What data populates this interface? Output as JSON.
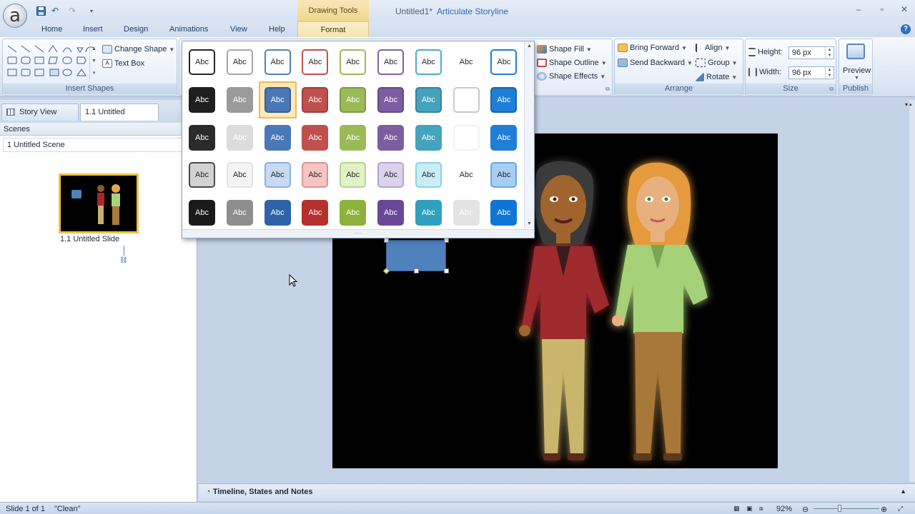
{
  "titlebar": {
    "document_title": "Untitled1*",
    "app_name": "Articulate Storyline",
    "context_tools": "Drawing Tools"
  },
  "tabs": [
    "Home",
    "Insert",
    "Design",
    "Animations",
    "View",
    "Help"
  ],
  "context_tab": "Format",
  "ribbon": {
    "insert_shapes_label": "Insert Shapes",
    "change_shape": "Change Shape",
    "text_box": "Text Box",
    "shape_fill": "Shape Fill",
    "shape_outline": "Shape Outline",
    "shape_effects": "Shape Effects",
    "bring_forward": "Bring Forward",
    "send_backward": "Send Backward",
    "align": "Align",
    "group": "Group",
    "rotate": "Rotate",
    "arrange_label": "Arrange",
    "height_label": "Height:",
    "height_value": "96 px",
    "width_label": "Width:",
    "width_value": "96 px",
    "size_label": "Size",
    "preview": "Preview",
    "publish_label": "Publish"
  },
  "left_panel": {
    "story_view_tab": "Story View",
    "slide_tab": "1.1 Untitled Slide",
    "scenes_header": "Scenes",
    "scene_item": "1 Untitled Scene",
    "thumb_label": "1.1 Untitled Slide"
  },
  "gallery": {
    "swatch_text": "Abc",
    "rows": [
      [
        {
          "fill": "#ffffff",
          "border": "#262626",
          "text": "#262626"
        },
        {
          "fill": "#ffffff",
          "border": "#a6a6a6",
          "text": "#262626"
        },
        {
          "fill": "#ffffff",
          "border": "#4f81bd",
          "text": "#262626"
        },
        {
          "fill": "#ffffff",
          "border": "#c0504d",
          "text": "#262626"
        },
        {
          "fill": "#ffffff",
          "border": "#9bbb59",
          "text": "#262626"
        },
        {
          "fill": "#ffffff",
          "border": "#8064a2",
          "text": "#262626"
        },
        {
          "fill": "#ffffff",
          "border": "#4bacc6",
          "text": "#262626"
        },
        {
          "fill": "#ffffff",
          "border": "#ffffff",
          "text": "#262626"
        },
        {
          "fill": "#ffffff",
          "border": "#1f7fd6",
          "text": "#262626"
        }
      ],
      [
        {
          "fill": "#1f1f1f",
          "border": "#1f1f1f",
          "text": "#ffffff"
        },
        {
          "fill": "#9b9b9b",
          "border": "#9b9b9b",
          "text": "#ffffff"
        },
        {
          "fill": "#4a78b6",
          "border": "#395f92",
          "text": "#ffffff"
        },
        {
          "fill": "#c0504d",
          "border": "#9d3c3a",
          "text": "#ffffff"
        },
        {
          "fill": "#9bbb59",
          "border": "#7d9a44",
          "text": "#ffffff"
        },
        {
          "fill": "#7c5ea0",
          "border": "#624a80",
          "text": "#ffffff"
        },
        {
          "fill": "#44a3bd",
          "border": "#35849a",
          "text": "#ffffff"
        },
        {
          "fill": "#ffffff",
          "border": "#c9c9c9",
          "text": "#ffffff"
        },
        {
          "fill": "#1f7fd6",
          "border": "#1865ab",
          "text": "#ffffff"
        }
      ],
      [
        {
          "fill": "#2b2b2b",
          "border": "#2b2b2b",
          "text": "#ffffff"
        },
        {
          "fill": "#dcdcdc",
          "border": "#dcdcdc",
          "text": "#ffffff"
        },
        {
          "fill": "#4a78b6",
          "border": "#4a78b6",
          "text": "#ffffff"
        },
        {
          "fill": "#c0504d",
          "border": "#c0504d",
          "text": "#ffffff"
        },
        {
          "fill": "#9bbb59",
          "border": "#9bbb59",
          "text": "#ffffff"
        },
        {
          "fill": "#7c5ea0",
          "border": "#7c5ea0",
          "text": "#ffffff"
        },
        {
          "fill": "#44a3bd",
          "border": "#44a3bd",
          "text": "#ffffff"
        },
        {
          "fill": "#ffffff",
          "border": "#f2f2f2",
          "text": "#ffffff"
        },
        {
          "fill": "#1f7fd6",
          "border": "#1f7fd6",
          "text": "#ffffff"
        }
      ],
      [
        {
          "fill": "#d2d2d2",
          "border": "#4a4a4a",
          "text": "#262626"
        },
        {
          "fill": "#f4f4f4",
          "border": "#e2e2e2",
          "text": "#262626"
        },
        {
          "fill": "#c7d9f3",
          "border": "#8eaedb",
          "text": "#262626"
        },
        {
          "fill": "#f6c5c3",
          "border": "#d99694",
          "text": "#262626"
        },
        {
          "fill": "#e2f2c6",
          "border": "#b6d48c",
          "text": "#262626"
        },
        {
          "fill": "#ddd2ec",
          "border": "#b3a2cf",
          "text": "#262626"
        },
        {
          "fill": "#c8eef8",
          "border": "#8fd0e2",
          "text": "#262626"
        },
        {
          "fill": "#ffffff",
          "border": "#ffffff",
          "text": "#262626"
        },
        {
          "fill": "#a7cdf3",
          "border": "#6aa6e0",
          "text": "#262626"
        }
      ],
      [
        {
          "fill": "#1a1a1a",
          "border": "#1a1a1a",
          "text": "#ffffff"
        },
        {
          "fill": "#8e8e8e",
          "border": "#8e8e8e",
          "text": "#ffffff"
        },
        {
          "fill": "#2f63a8",
          "border": "#2f63a8",
          "text": "#ffffff"
        },
        {
          "fill": "#b5302d",
          "border": "#b5302d",
          "text": "#ffffff"
        },
        {
          "fill": "#8cb23a",
          "border": "#8cb23a",
          "text": "#ffffff"
        },
        {
          "fill": "#6b4797",
          "border": "#6b4797",
          "text": "#ffffff"
        },
        {
          "fill": "#2fa0bf",
          "border": "#2fa0bf",
          "text": "#ffffff"
        },
        {
          "fill": "#e3e3e3",
          "border": "#e3e3e3",
          "text": "#ffffff"
        },
        {
          "fill": "#0f76d8",
          "border": "#0f76d8",
          "text": "#ffffff"
        }
      ]
    ],
    "selected": {
      "row": 1,
      "col": 2
    }
  },
  "canvas": {
    "stage_color": "#000000",
    "shape_color": "#4f81bd"
  },
  "timeline": {
    "label": "Timeline, States and Notes"
  },
  "status": {
    "slide": "Slide 1 of 1",
    "theme": "\"Clean\"",
    "zoom": "92%"
  }
}
